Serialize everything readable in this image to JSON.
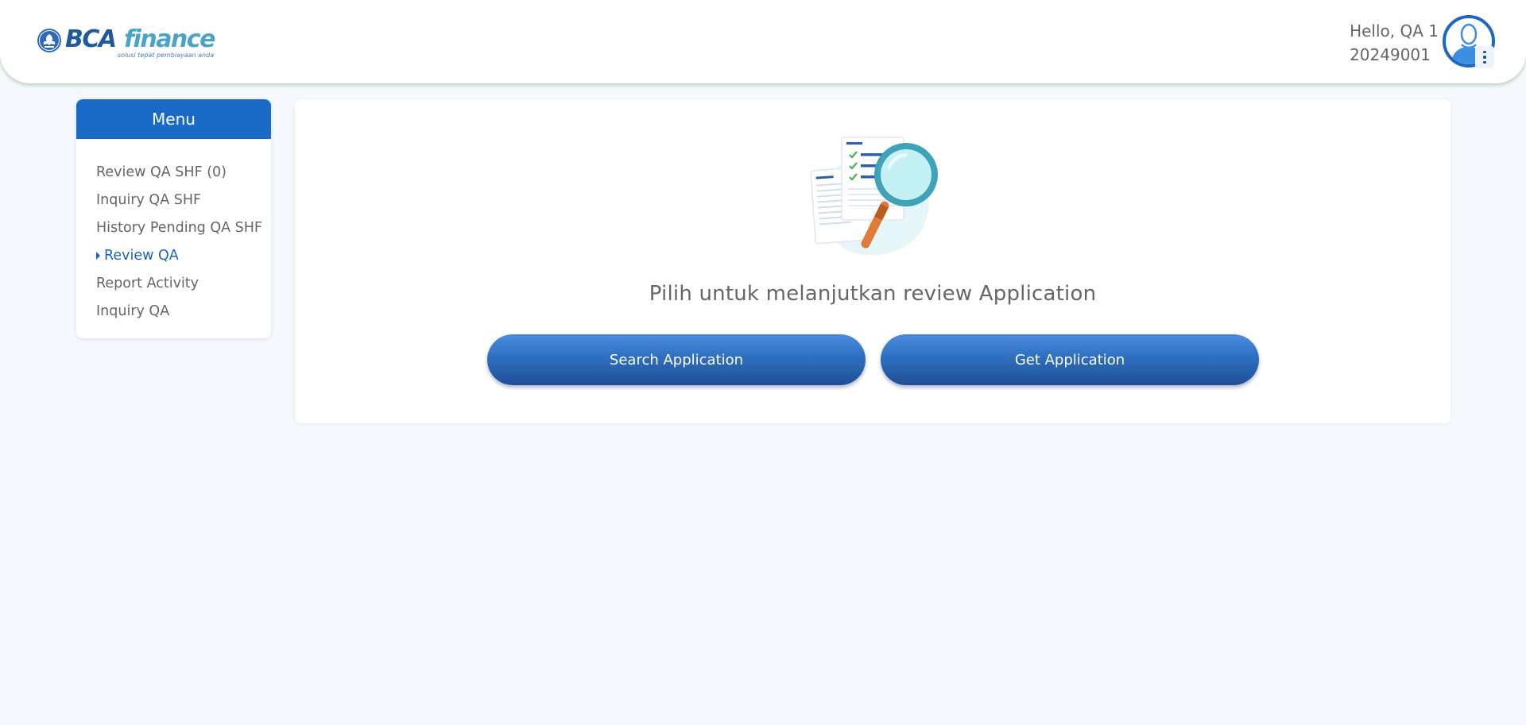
{
  "brand": {
    "name_part1": "BCA",
    "name_part2": "finance",
    "tagline": "solusi tepat pembiayaan anda",
    "primary_color": "#1a6ac8",
    "accent_color": "#4aa3c8"
  },
  "header": {
    "greeting": "Hello, QA 1",
    "user_id": "20249001",
    "avatar_icon": "user-avatar-icon",
    "menu_icon": "kebab-menu-icon"
  },
  "sidebar": {
    "title": "Menu",
    "items": [
      {
        "label": "Review QA SHF (0)",
        "active": false
      },
      {
        "label": "Inquiry QA SHF",
        "active": false
      },
      {
        "label": "History Pending QA SHF",
        "active": false
      },
      {
        "label": "Review QA",
        "active": true
      },
      {
        "label": "Report Activity",
        "active": false
      },
      {
        "label": "Inquiry QA",
        "active": false
      }
    ]
  },
  "main": {
    "illustration_icon": "document-search-illustration",
    "prompt": "Pilih untuk melanjutkan review Application",
    "buttons": {
      "search_label": "Search Application",
      "get_label": "Get Application"
    }
  }
}
